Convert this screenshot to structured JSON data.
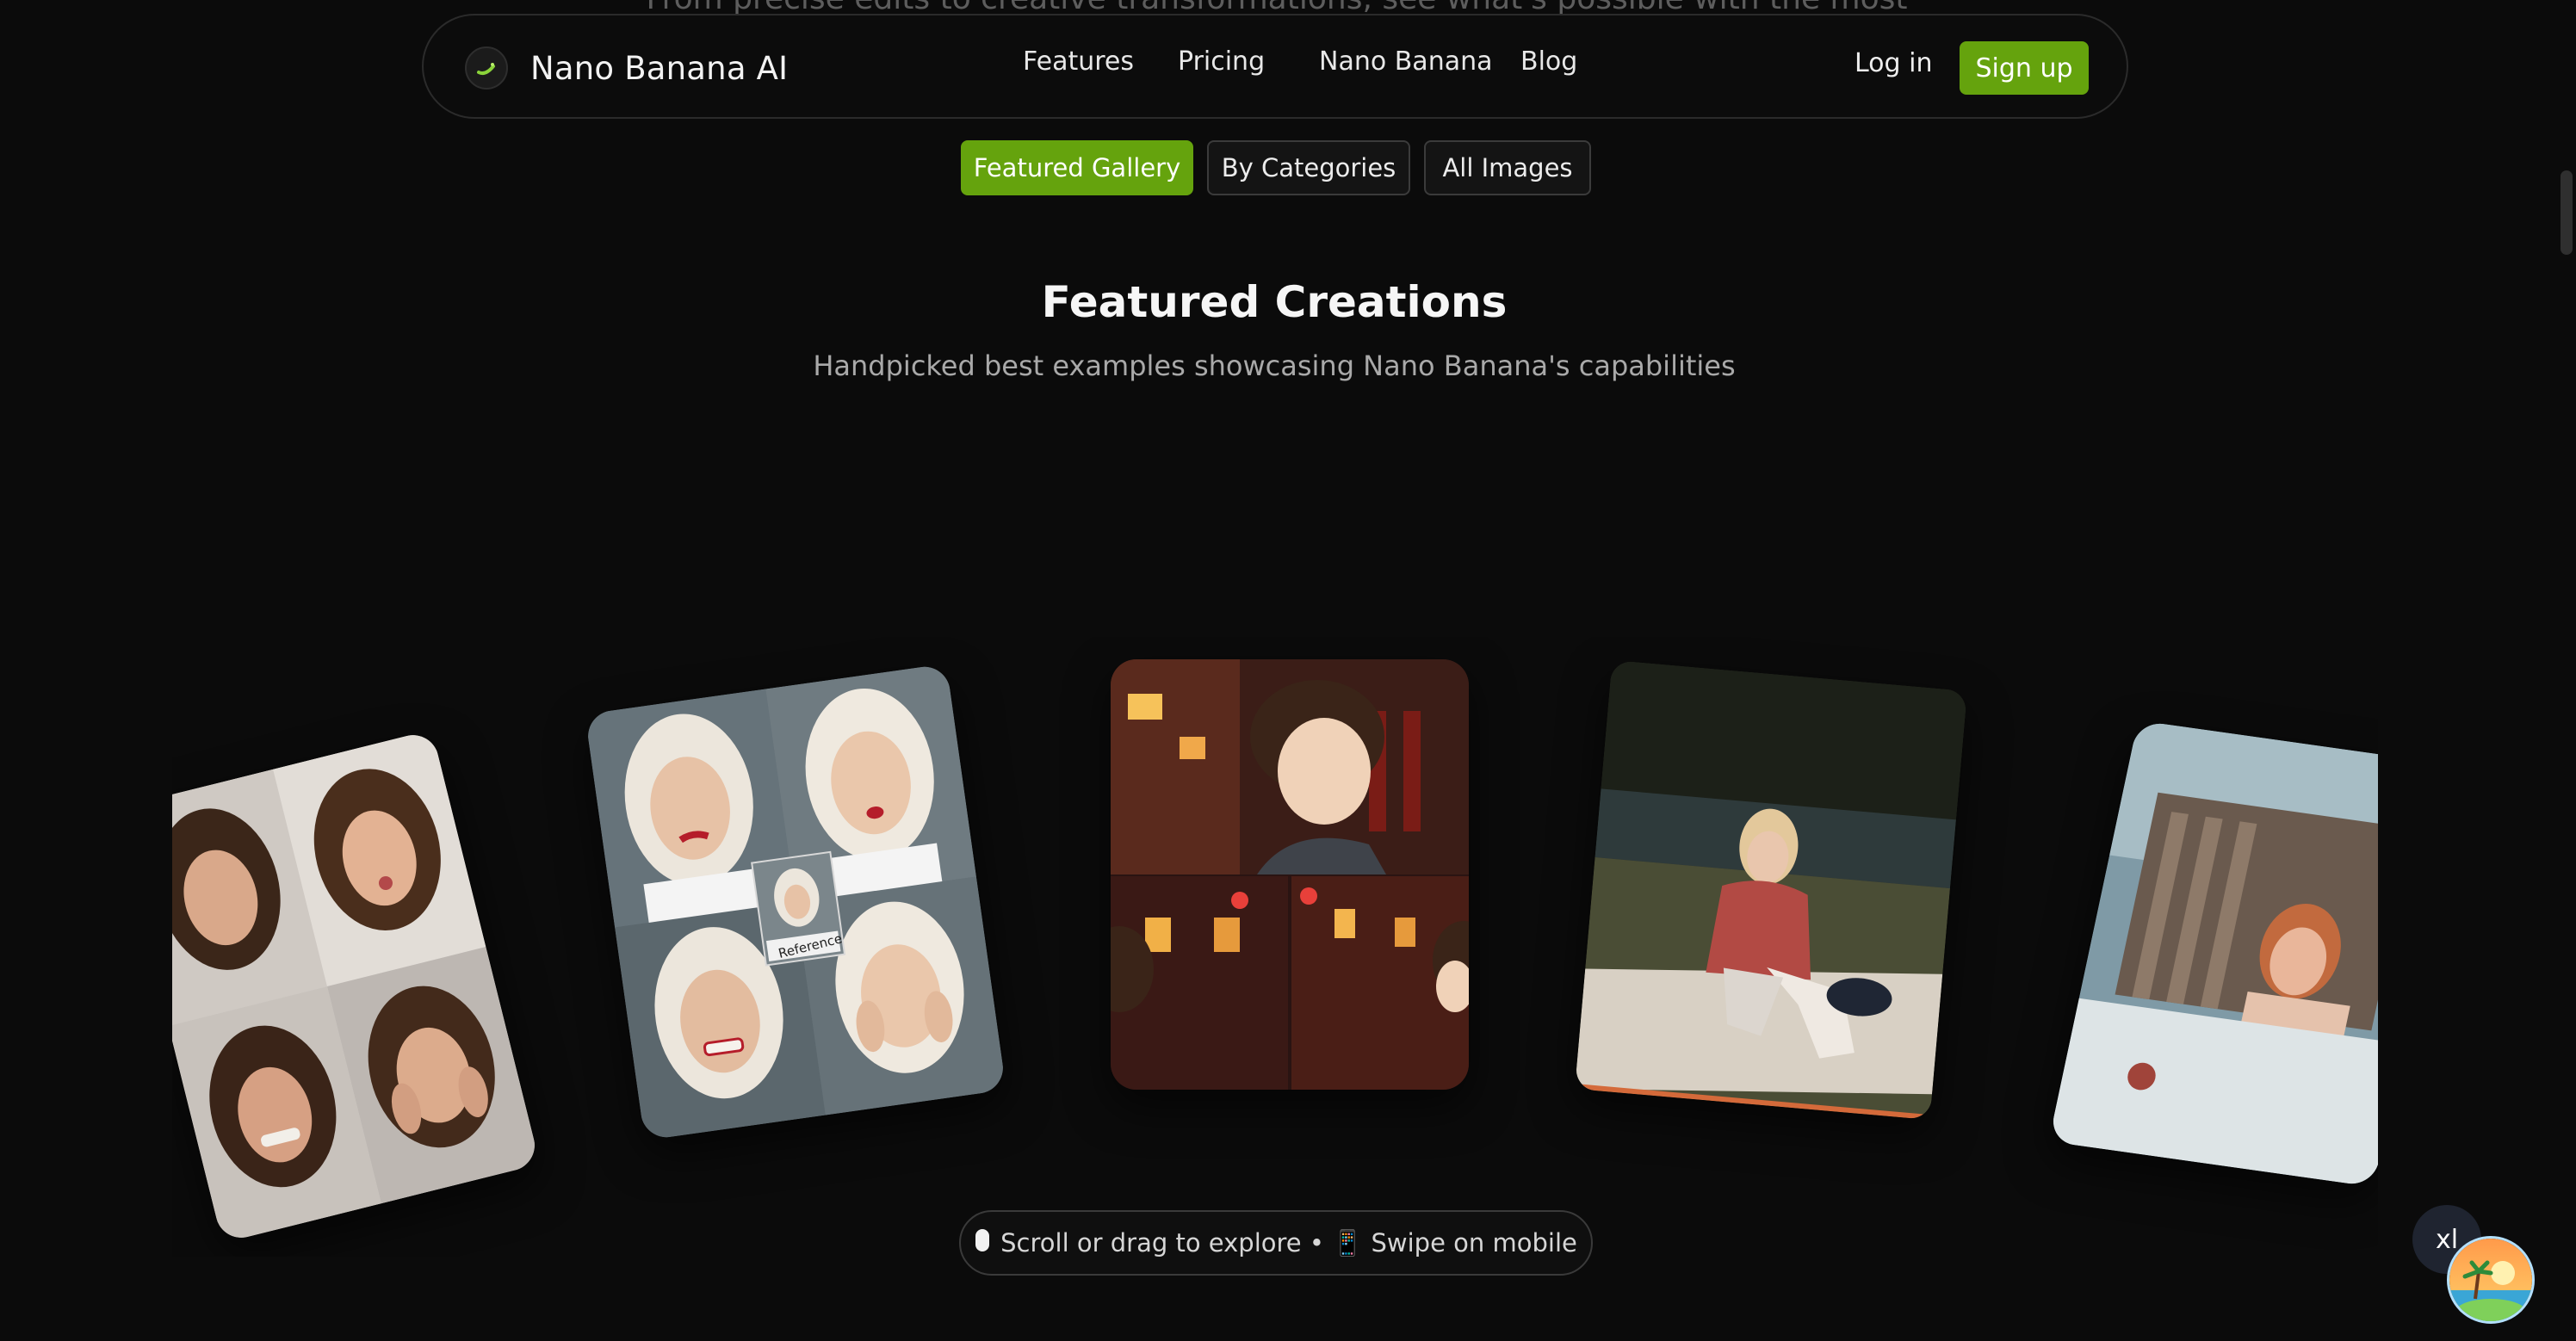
{
  "intro": {
    "text": "From precise edits to creative transformations, see what's possible with the most"
  },
  "navbar": {
    "brand": "Nano Banana AI",
    "links": [
      "Features",
      "Pricing",
      "Nano Banana",
      "Blog"
    ],
    "login": "Log in",
    "signup": "Sign up"
  },
  "tabs": {
    "featured": "Featured Gallery",
    "categories": "By Categories",
    "all": "All Images",
    "active": "Featured Gallery"
  },
  "section": {
    "title": "Featured Creations",
    "subtitle": "Handpicked best examples showcasing Nano Banana's capabilities"
  },
  "gallery": {
    "reference_label": "Reference",
    "items": [
      {
        "subject": "curly-hair-expressions-grid"
      },
      {
        "subject": "platinum-hair-expressions-grid"
      },
      {
        "subject": "anime-character-storyboard"
      },
      {
        "subject": "vintage-photo-woman-on-blanket"
      },
      {
        "subject": "woman-leaning-on-window"
      }
    ]
  },
  "hint": {
    "text": "Scroll or drag to explore • 📱 Swipe on mobile",
    "icon": "mouse-icon"
  },
  "widget": {
    "badge": "xl"
  },
  "colors": {
    "accent": "#65a30d",
    "background": "#0b0b0b"
  }
}
